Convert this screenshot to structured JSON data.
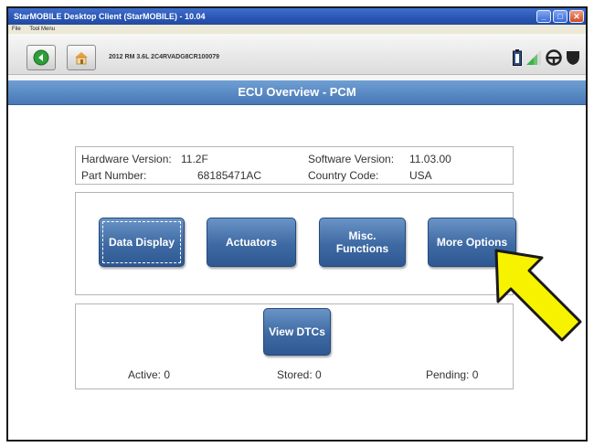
{
  "window": {
    "title": "StarMOBILE Desktop Client (StarMOBILE) - 10.04",
    "minimize": "_",
    "maximize": "□",
    "close": "✕"
  },
  "menu": [
    "File",
    "Tool Menu"
  ],
  "toolbar": {
    "vehicle": "2012  RM  3.6L  2C4RVADG8CR100079",
    "icons": [
      "back-icon",
      "home-icon",
      "battery-icon",
      "signal-icon",
      "steering-wheel-icon",
      "shield-icon"
    ]
  },
  "header": {
    "title": "ECU Overview - PCM"
  },
  "info": {
    "hardware_label": "Hardware Version:",
    "hardware_value": "11.2F",
    "software_label": "Software Version:",
    "software_value": "11.03.00",
    "part_label": "Part Number:",
    "part_value": "68185471AC",
    "country_label": "Country Code:",
    "country_value": "USA"
  },
  "buttons": {
    "data_display": "Data Display",
    "actuators": "Actuators",
    "misc_line1": "Misc.",
    "misc_line2": "Functions",
    "more_options": "More Options",
    "view_dtcs": "View DTCs"
  },
  "dtc_counts": {
    "active": "Active:  0",
    "stored": "Stored:  0",
    "pending": "Pending:  0"
  },
  "colors": {
    "header": "#5b8cc7",
    "button": "#3e6aa3",
    "arrow": "#f7f200",
    "titlebar": "#2a55b3"
  }
}
